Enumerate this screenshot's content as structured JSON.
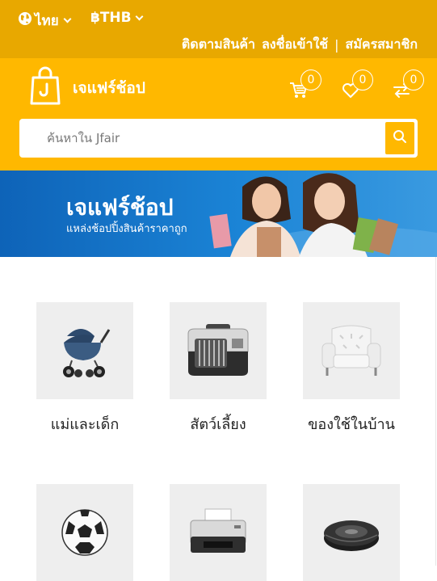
{
  "topbar": {
    "language": "ไทย",
    "currency": "฿THB",
    "links": {
      "track": "ติดตามสินค้า",
      "login": "ลงชื่อเข้าใช้",
      "separator": "|",
      "register": "สมัครสมาชิก"
    }
  },
  "header": {
    "brand": "เจแฟร์ช้อป",
    "cart_count": "0",
    "wishlist_count": "0",
    "compare_count": "0"
  },
  "search": {
    "placeholder": "ค้นหาใน Jfair"
  },
  "banner": {
    "title": "เจแฟร์ช้อป",
    "subtitle": "แหล่งช้อปปิ้งสินค้าราคาถูก"
  },
  "categories": [
    {
      "label": "แม่และเด็ก",
      "icon": "stroller-icon"
    },
    {
      "label": "สัตว์เลี้ยง",
      "icon": "pet-carrier-icon"
    },
    {
      "label": "ของใช้ในบ้าน",
      "icon": "armchair-icon"
    },
    {
      "label": "",
      "icon": "soccer-ball-icon"
    },
    {
      "label": "",
      "icon": "printer-icon"
    },
    {
      "label": "",
      "icon": "robot-vacuum-icon"
    }
  ],
  "colors": {
    "topbar": "#e8a800",
    "header": "#ffb800",
    "banner": "#1b84d6"
  }
}
